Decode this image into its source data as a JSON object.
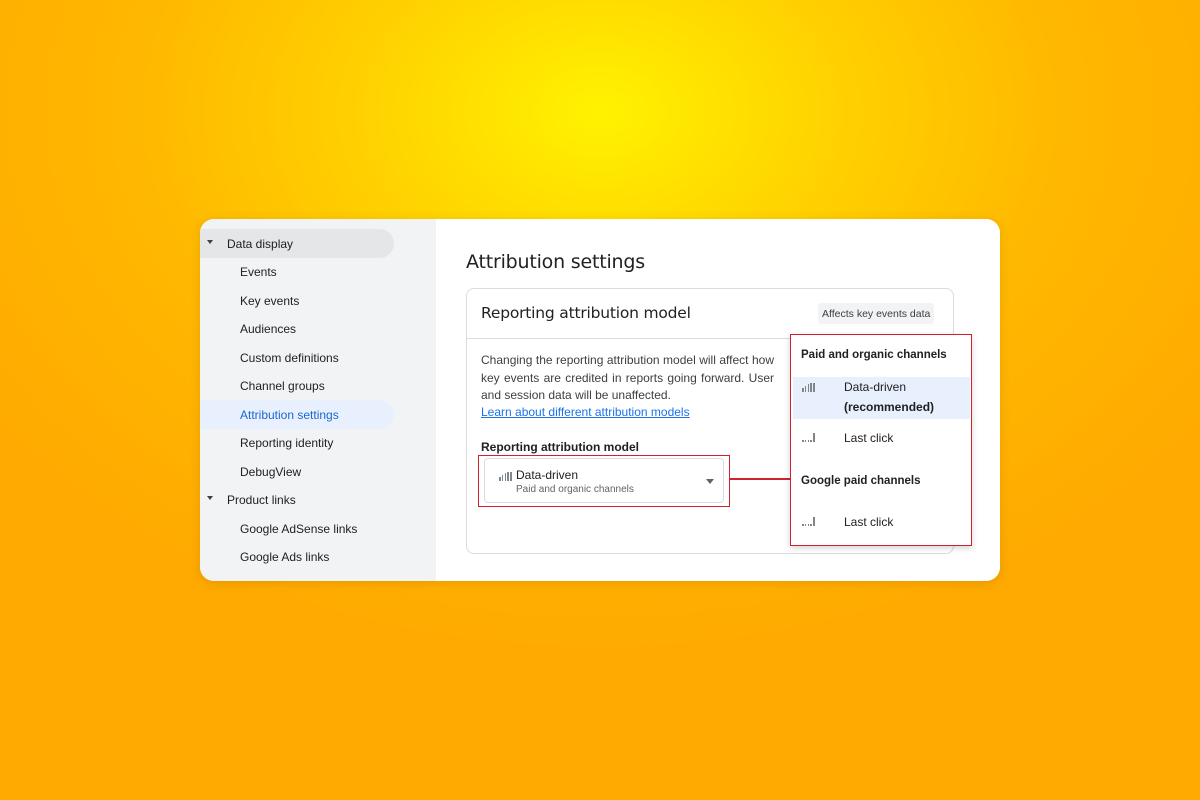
{
  "sidebar": {
    "groups": [
      {
        "label": "Data display"
      },
      {
        "label": "Product links"
      }
    ],
    "items": [
      {
        "label": "Events"
      },
      {
        "label": "Key events"
      },
      {
        "label": "Audiences"
      },
      {
        "label": "Custom definitions"
      },
      {
        "label": "Channel groups"
      },
      {
        "label": "Attribution settings"
      },
      {
        "label": "Reporting identity"
      },
      {
        "label": "DebugView"
      },
      {
        "label": "Google AdSense links"
      },
      {
        "label": "Google Ads links"
      }
    ],
    "active_item": "Attribution settings"
  },
  "main": {
    "title": "Attribution settings",
    "card": {
      "title": "Reporting attribution model",
      "chip": "Affects key events data",
      "description": "Changing the reporting attribution model will affect how key events are credited in reports going forward. User and session data will be unaffected.",
      "link": "Learn about different attribution models",
      "field_label": "Reporting attribution model",
      "select": {
        "value": "Data-driven",
        "sub": "Paid and organic channels",
        "icon": "bar-chart-icon"
      }
    }
  },
  "menu": {
    "sections": [
      {
        "heading": "Paid and organic channels",
        "options": [
          {
            "label": "Data-driven",
            "label_bold": "(recommended)",
            "icon": "bar-chart-icon"
          },
          {
            "label": "Last click",
            "icon": "bar-chart-icon"
          }
        ]
      },
      {
        "heading": "Google paid channels",
        "options": [
          {
            "label": "Last click",
            "icon": "bar-chart-icon"
          }
        ]
      }
    ]
  },
  "colors": {
    "highlight": "#d0222c",
    "accent": "#1967d2",
    "selected_bg": "#e8f0fe",
    "background_top": "#fff200",
    "background_bottom": "#ffaa00"
  }
}
